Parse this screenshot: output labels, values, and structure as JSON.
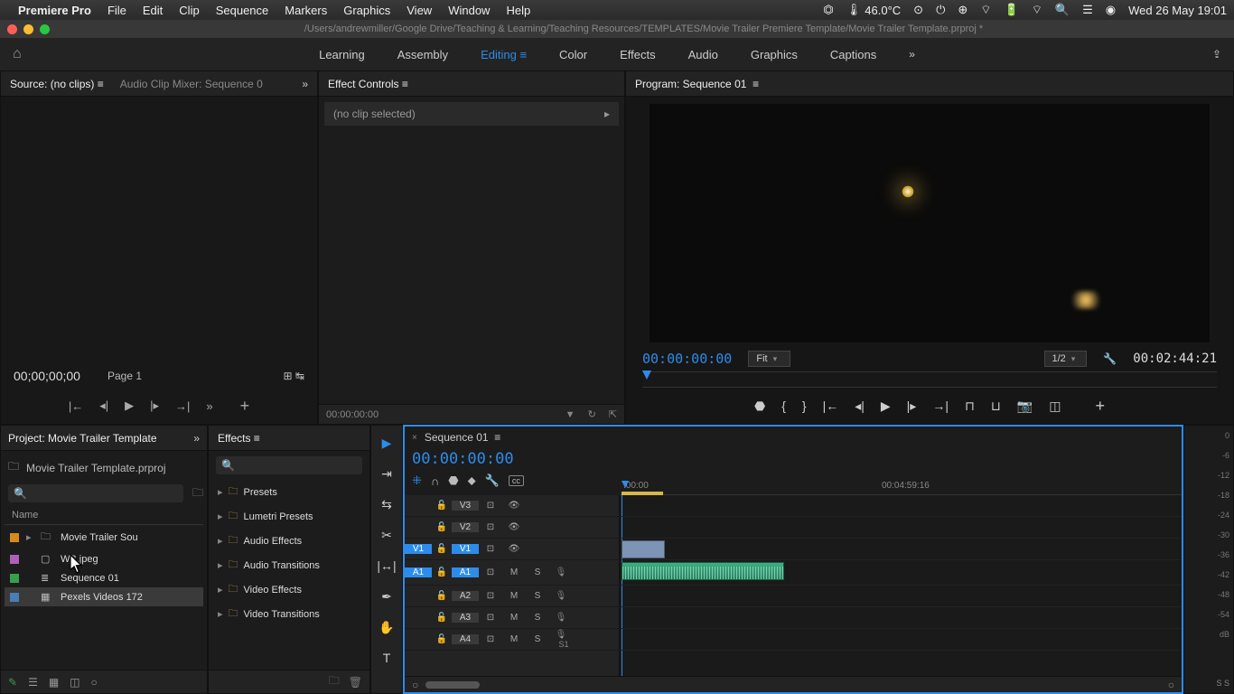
{
  "mac_menu": {
    "app": "Premiere Pro",
    "items": [
      "File",
      "Edit",
      "Clip",
      "Sequence",
      "Markers",
      "Graphics",
      "View",
      "Window",
      "Help"
    ],
    "temp": "46.0°C",
    "clock": "Wed 26 May  19:01"
  },
  "title_bar": {
    "path": "/Users/andrewmiller/Google Drive/Teaching & Learning/Teaching Resources/TEMPLATES/Movie Trailer Premiere Template/Movie Trailer Template.prproj *"
  },
  "workspaces": {
    "tabs": [
      "Learning",
      "Assembly",
      "Editing",
      "Color",
      "Effects",
      "Audio",
      "Graphics",
      "Captions"
    ],
    "active": "Editing"
  },
  "source_panel": {
    "tab1": "Source: (no clips)",
    "tab2": "Audio Clip Mixer: Sequence 0",
    "timecode": "00;00;00;00",
    "page": "Page 1"
  },
  "effect_controls": {
    "title": "Effect Controls",
    "noclip": "(no clip selected)",
    "tc": "00:00:00:00"
  },
  "program": {
    "title": "Program: Sequence 01",
    "tc_in": "00:00:00:00",
    "fit": "Fit",
    "res": "1/2",
    "duration": "00:02:44:21"
  },
  "project": {
    "title": "Project: Movie Trailer Template",
    "bin_label": "Movie Trailer Template.prproj",
    "col_name": "Name",
    "items": [
      {
        "color": "#d68a1c",
        "name": "Movie Trailer Sou",
        "type": "bin",
        "expand": true
      },
      {
        "color": "#b05fb8",
        "name": "WB.jpeg",
        "type": "image"
      },
      {
        "color": "#3a9e4f",
        "name": "Sequence 01",
        "type": "sequence"
      },
      {
        "color": "#4a7db5",
        "name": "Pexels Videos 172",
        "type": "video"
      }
    ]
  },
  "effects_panel": {
    "title": "Effects",
    "folders": [
      "Presets",
      "Lumetri Presets",
      "Audio Effects",
      "Audio Transitions",
      "Video Effects",
      "Video Transitions"
    ]
  },
  "timeline": {
    "seq_name": "Sequence 01",
    "tc": "00:00:00:00",
    "ruler": {
      "t0": ":00:00",
      "t1": "00:04:59:16"
    },
    "video_tracks": [
      {
        "src": "",
        "tgt": "V3"
      },
      {
        "src": "",
        "tgt": "V2"
      },
      {
        "src": "V1",
        "tgt": "V1",
        "src_on": true,
        "tgt_on": true
      }
    ],
    "audio_tracks": [
      {
        "src": "A1",
        "tgt": "A1",
        "src_on": true,
        "tgt_on": true
      },
      {
        "src": "",
        "tgt": "A2"
      },
      {
        "src": "",
        "tgt": "A3"
      },
      {
        "src": "",
        "tgt": "A4"
      }
    ],
    "s1_label": "S1"
  },
  "meters": {
    "scale": [
      "0",
      "-6",
      "-12",
      "-18",
      "-24",
      "-30",
      "-36",
      "-42",
      "-48",
      "-54",
      "dB"
    ],
    "label": "S  S"
  }
}
